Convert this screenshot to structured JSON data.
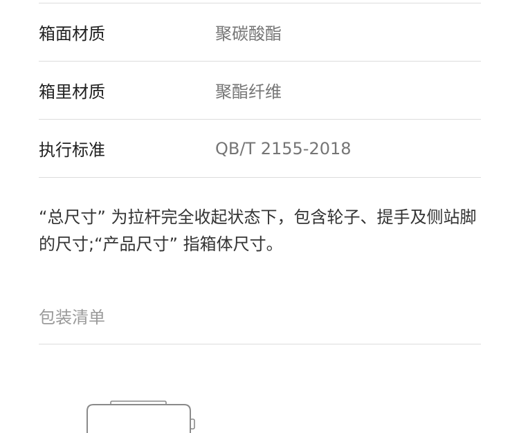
{
  "specs": [
    {
      "key": "箱面材质",
      "value": "聚碳酸酯"
    },
    {
      "key": "箱里材质",
      "value": "聚酯纤维"
    },
    {
      "key": "执行标准",
      "value": "QB/T 2155-2018"
    }
  ],
  "note": "“总尺寸” 为拉杆完全收起状态下，包含轮子、提手及侧站脚的尺寸;“产品尺寸” 指箱体尺寸。",
  "package": {
    "title": "包装清单"
  },
  "colors": {
    "divider": "#dcdcdc",
    "label": "#1f1f1f",
    "value": "#757575",
    "section_title": "#9a9a9a"
  },
  "icons": [
    "suitcase-outline"
  ]
}
